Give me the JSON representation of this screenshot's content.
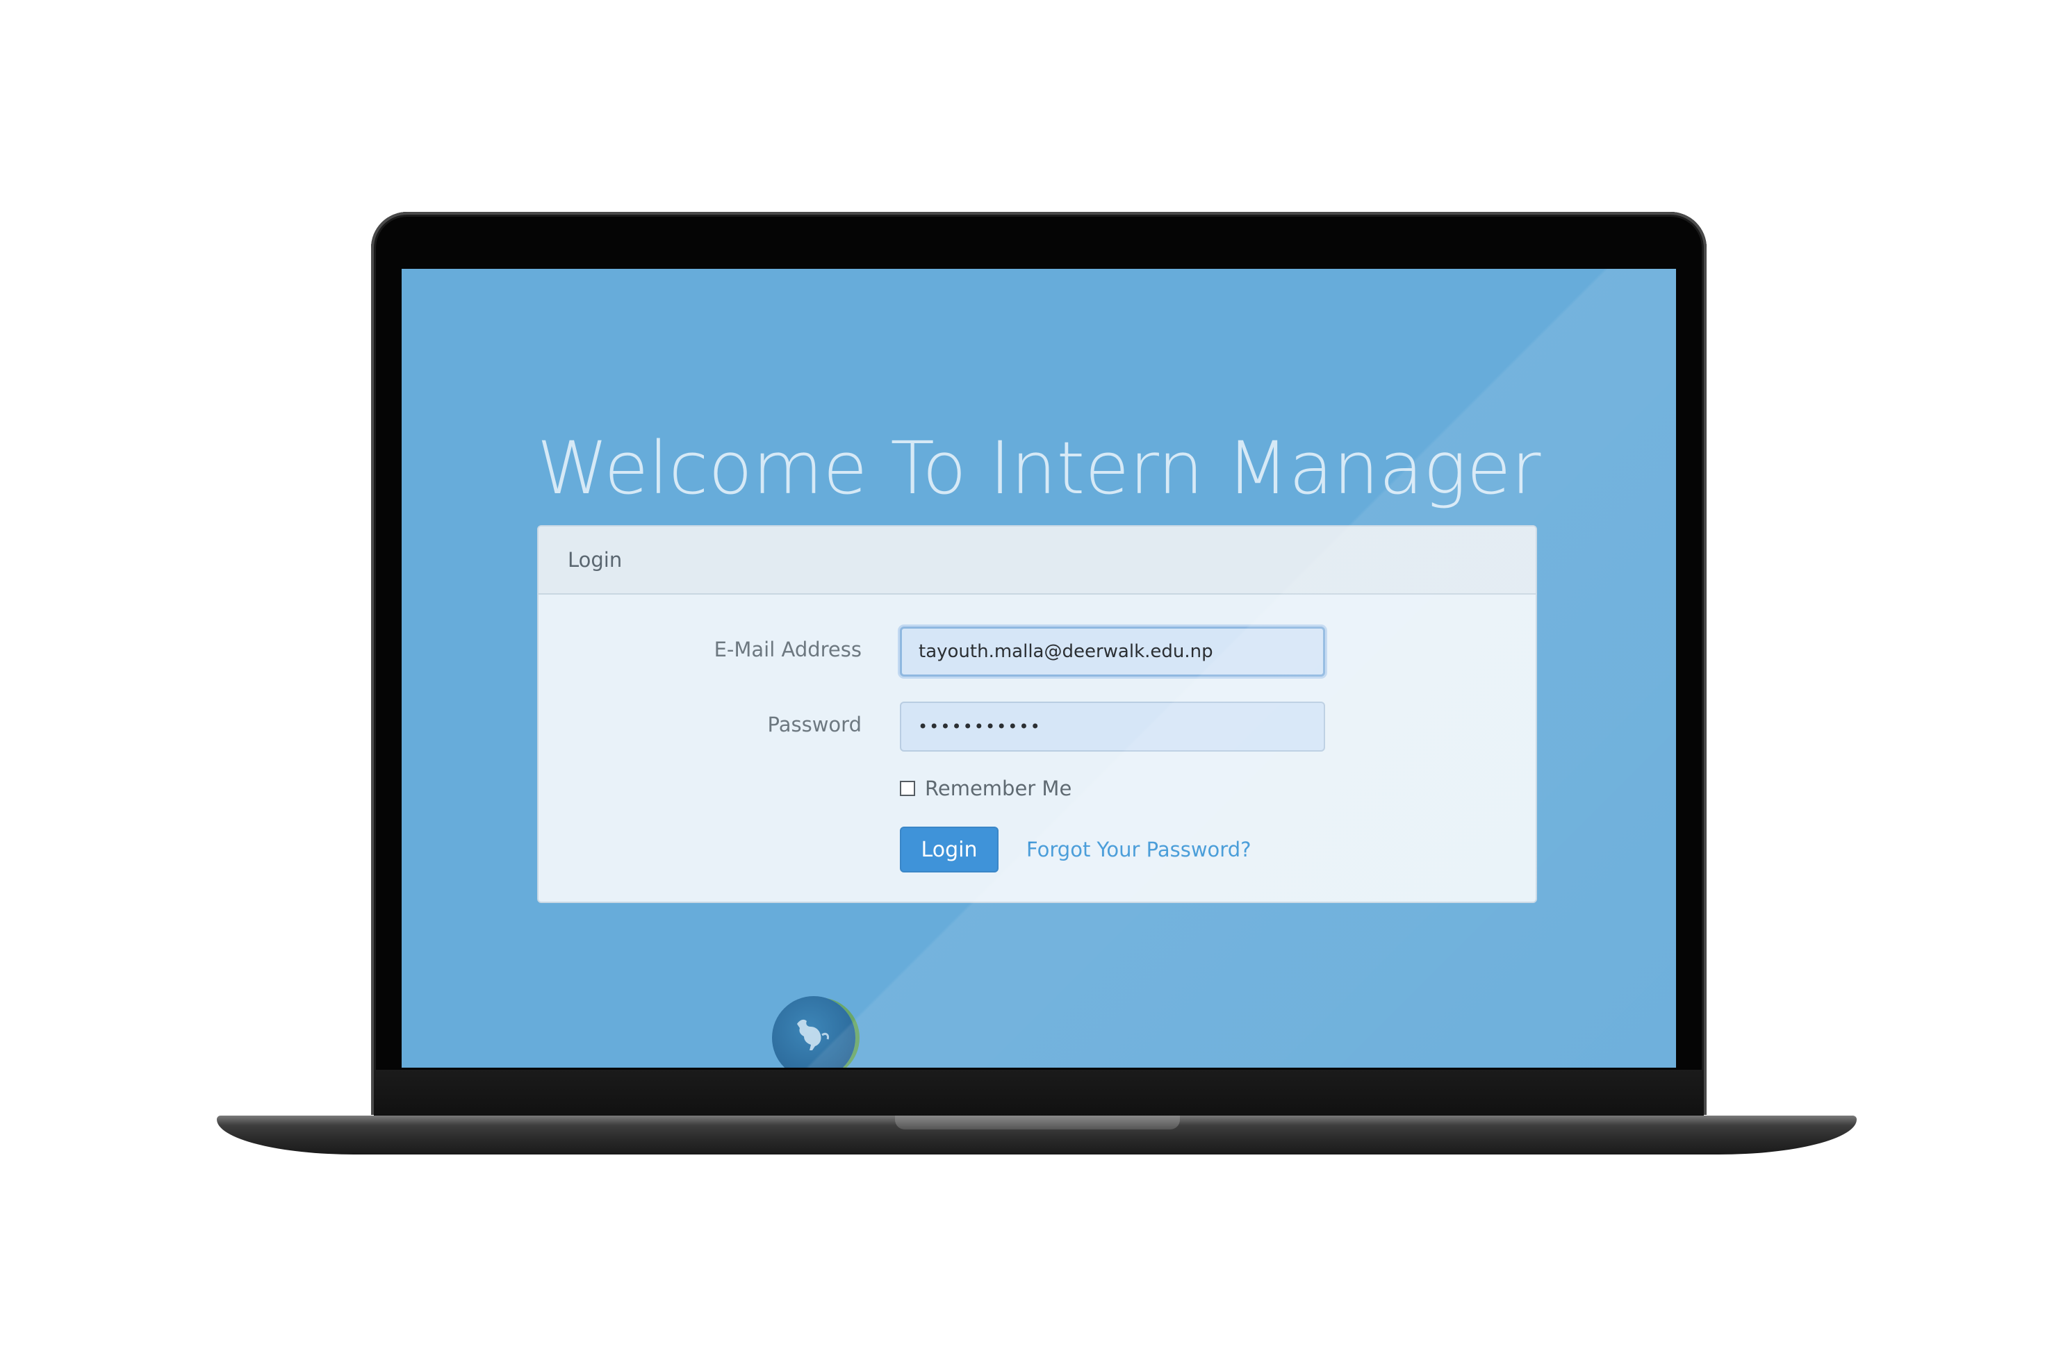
{
  "page": {
    "title": "Welcome To Intern Manager"
  },
  "login_panel": {
    "heading": "Login",
    "email_label": "E-Mail Address",
    "email_value": "tayouth.malla@deerwalk.edu.np",
    "password_label": "Password",
    "password_value": "•••••••••••",
    "remember_label": "Remember Me",
    "remember_checked": false,
    "login_button": "Login",
    "forgot_link": "Forgot Your Password?"
  },
  "colors": {
    "screen_background": "#67acda",
    "button_primary": "#3f93d9",
    "link": "#3b95d6"
  },
  "icons": {
    "logo": "deer-logo-icon"
  }
}
